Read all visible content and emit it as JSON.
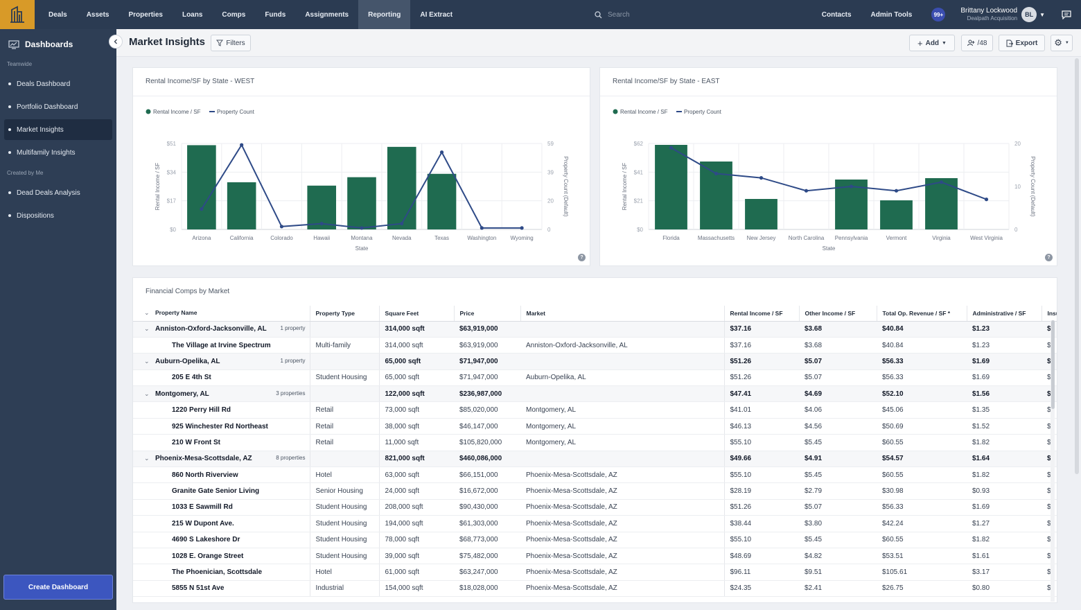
{
  "nav": {
    "items": [
      {
        "label": "Deals",
        "active": false
      },
      {
        "label": "Assets",
        "active": false
      },
      {
        "label": "Properties",
        "active": false
      },
      {
        "label": "Loans",
        "active": false
      },
      {
        "label": "Comps",
        "active": false
      },
      {
        "label": "Funds",
        "active": false
      },
      {
        "label": "Assignments",
        "active": false
      },
      {
        "label": "Reporting",
        "active": true
      },
      {
        "label": "AI Extract",
        "active": false
      }
    ],
    "search_placeholder": "Search",
    "contacts": "Contacts",
    "admin_tools": "Admin Tools",
    "notification_badge": "99+",
    "user_name": "Brittany Lockwood",
    "user_org": "Dealpath Acquisition",
    "avatar_initials": "BL",
    "colors": {
      "nav_bg": "#2b3b52",
      "logo_bg": "#d89a28",
      "active_bg": "#45556b"
    }
  },
  "sidebar": {
    "title": "Dashboards",
    "section_teamwide": "Teamwide",
    "teamwide": [
      {
        "label": "Deals Dashboard",
        "active": false
      },
      {
        "label": "Portfolio Dashboard",
        "active": false
      },
      {
        "label": "Market Insights",
        "active": true
      },
      {
        "label": "Multifamily Insights",
        "active": false
      }
    ],
    "section_mine": "Created by Me",
    "mine": [
      {
        "label": "Dead Deals Analysis",
        "active": false
      },
      {
        "label": "Dispositions",
        "active": false
      }
    ],
    "create_button": "Create Dashboard"
  },
  "header": {
    "title": "Market Insights",
    "filters": "Filters",
    "add": "Add",
    "share_count": "/48",
    "export": "Export"
  },
  "charts": {
    "west_title": "Rental Income/SF by State - WEST",
    "east_title": "Rental Income/SF by State - EAST",
    "table_title": "Financial Comps by Market"
  },
  "chart_data": [
    {
      "type": "bar",
      "title": "Rental Income/SF by State - WEST",
      "xlabel": "State",
      "ylabel": "Rental Income / SF",
      "y2label": "Property Count (Default)",
      "categories": [
        "Arizona",
        "California",
        "Colorado",
        "Hawaii",
        "Montana",
        "Nevada",
        "Texas",
        "Washington",
        "Wyoming"
      ],
      "series": [
        {
          "name": "Rental Income / SF",
          "type": "bar",
          "axis": "left",
          "values": [
            50,
            28,
            null,
            26,
            31,
            49,
            33,
            null,
            null
          ]
        },
        {
          "name": "Property Count",
          "type": "line",
          "axis": "right",
          "values": [
            14,
            58,
            2,
            4,
            1,
            4,
            53,
            1,
            1
          ]
        }
      ],
      "yticks": [
        "$0",
        "$17",
        "$34",
        "$51"
      ],
      "ylim": [
        0,
        51
      ],
      "y2ticks": [
        "0",
        "20",
        "39",
        "59"
      ],
      "y2lim": [
        0,
        59
      ],
      "legend": "top-left",
      "grid": true,
      "colors": {
        "bar": "#1f6b50",
        "line": "#2e4a87"
      }
    },
    {
      "type": "bar",
      "title": "Rental Income/SF by State - EAST",
      "xlabel": "State",
      "ylabel": "Rental Income / SF",
      "y2label": "Property Count (Default)",
      "categories": [
        "Florida",
        "Massachusetts",
        "New Jersey",
        "North Carolina",
        "Pennsylvania",
        "Vermont",
        "Virginia",
        "West Virginia"
      ],
      "series": [
        {
          "name": "Rental Income / SF",
          "type": "bar",
          "axis": "left",
          "values": [
            61,
            49,
            22,
            null,
            36,
            21,
            37,
            null
          ]
        },
        {
          "name": "Property Count",
          "type": "line",
          "axis": "right",
          "values": [
            19,
            13,
            12,
            9,
            10,
            9,
            11,
            7
          ]
        }
      ],
      "yticks": [
        "$0",
        "$21",
        "$41",
        "$62"
      ],
      "ylim": [
        0,
        62
      ],
      "y2ticks": [
        "0",
        "10",
        "20"
      ],
      "y2lim": [
        0,
        20
      ],
      "legend": "top-left",
      "grid": true,
      "colors": {
        "bar": "#1f6b50",
        "line": "#2e4a87"
      }
    }
  ],
  "table": {
    "columns": [
      "Property Name",
      "Property Type",
      "Square Feet",
      "Price",
      "Market",
      "Rental Income / SF",
      "Other Income / SF",
      "Total Op. Revenue / SF *",
      "Administrative / SF",
      "Insu"
    ],
    "rows": [
      {
        "kind": "group",
        "name": "Anniston-Oxford-Jacksonville, AL",
        "count": "1 property",
        "type": "",
        "sqft": "314,000 sqft",
        "price": "$63,919,000",
        "market": "",
        "rent": "$37.16",
        "other": "$3.68",
        "rev": "$40.84",
        "admin": "$1.23",
        "ins": "$"
      },
      {
        "kind": "child",
        "name": "The Village at Irvine Spectrum",
        "type": "Multi-family",
        "sqft": "314,000 sqft",
        "price": "$63,919,000",
        "market": "Anniston-Oxford-Jacksonville, AL",
        "rent": "$37.16",
        "other": "$3.68",
        "rev": "$40.84",
        "admin": "$1.23",
        "ins": "$"
      },
      {
        "kind": "group",
        "name": "Auburn-Opelika, AL",
        "count": "1 property",
        "type": "",
        "sqft": "65,000 sqft",
        "price": "$71,947,000",
        "market": "",
        "rent": "$51.26",
        "other": "$5.07",
        "rev": "$56.33",
        "admin": "$1.69",
        "ins": "$"
      },
      {
        "kind": "child",
        "name": "205 E 4th St",
        "type": "Student Housing",
        "sqft": "65,000 sqft",
        "price": "$71,947,000",
        "market": "Auburn-Opelika, AL",
        "rent": "$51.26",
        "other": "$5.07",
        "rev": "$56.33",
        "admin": "$1.69",
        "ins": "$"
      },
      {
        "kind": "group",
        "name": "Montgomery, AL",
        "count": "3 properties",
        "type": "",
        "sqft": "122,000 sqft",
        "price": "$236,987,000",
        "market": "",
        "rent": "$47.41",
        "other": "$4.69",
        "rev": "$52.10",
        "admin": "$1.56",
        "ins": "$"
      },
      {
        "kind": "child",
        "name": "1220 Perry Hill Rd",
        "type": "Retail",
        "sqft": "73,000 sqft",
        "price": "$85,020,000",
        "market": "Montgomery, AL",
        "rent": "$41.01",
        "other": "$4.06",
        "rev": "$45.06",
        "admin": "$1.35",
        "ins": "$"
      },
      {
        "kind": "child",
        "name": "925 Winchester Rd Northeast",
        "type": "Retail",
        "sqft": "38,000 sqft",
        "price": "$46,147,000",
        "market": "Montgomery, AL",
        "rent": "$46.13",
        "other": "$4.56",
        "rev": "$50.69",
        "admin": "$1.52",
        "ins": "$"
      },
      {
        "kind": "child",
        "name": "210 W Front St",
        "type": "Retail",
        "sqft": "11,000 sqft",
        "price": "$105,820,000",
        "market": "Montgomery, AL",
        "rent": "$55.10",
        "other": "$5.45",
        "rev": "$60.55",
        "admin": "$1.82",
        "ins": "$"
      },
      {
        "kind": "group",
        "name": "Phoenix-Mesa-Scottsdale, AZ",
        "count": "8 properties",
        "type": "",
        "sqft": "821,000 sqft",
        "price": "$460,086,000",
        "market": "",
        "rent": "$49.66",
        "other": "$4.91",
        "rev": "$54.57",
        "admin": "$1.64",
        "ins": "$"
      },
      {
        "kind": "child",
        "name": "860 North Riverview",
        "type": "Hotel",
        "sqft": "63,000 sqft",
        "price": "$66,151,000",
        "market": "Phoenix-Mesa-Scottsdale, AZ",
        "rent": "$55.10",
        "other": "$5.45",
        "rev": "$60.55",
        "admin": "$1.82",
        "ins": "$"
      },
      {
        "kind": "child",
        "name": "Granite Gate Senior Living",
        "type": "Senior Housing",
        "sqft": "24,000 sqft",
        "price": "$16,672,000",
        "market": "Phoenix-Mesa-Scottsdale, AZ",
        "rent": "$28.19",
        "other": "$2.79",
        "rev": "$30.98",
        "admin": "$0.93",
        "ins": "$"
      },
      {
        "kind": "child",
        "name": "1033 E Sawmill Rd",
        "type": "Student Housing",
        "sqft": "208,000 sqft",
        "price": "$90,430,000",
        "market": "Phoenix-Mesa-Scottsdale, AZ",
        "rent": "$51.26",
        "other": "$5.07",
        "rev": "$56.33",
        "admin": "$1.69",
        "ins": "$"
      },
      {
        "kind": "child",
        "name": "215 W Dupont Ave.",
        "type": "Student Housing",
        "sqft": "194,000 sqft",
        "price": "$61,303,000",
        "market": "Phoenix-Mesa-Scottsdale, AZ",
        "rent": "$38.44",
        "other": "$3.80",
        "rev": "$42.24",
        "admin": "$1.27",
        "ins": "$"
      },
      {
        "kind": "child",
        "name": "4690 S Lakeshore Dr",
        "type": "Student Housing",
        "sqft": "78,000 sqft",
        "price": "$68,773,000",
        "market": "Phoenix-Mesa-Scottsdale, AZ",
        "rent": "$55.10",
        "other": "$5.45",
        "rev": "$60.55",
        "admin": "$1.82",
        "ins": "$"
      },
      {
        "kind": "child",
        "name": "1028 E. Orange Street",
        "type": "Student Housing",
        "sqft": "39,000 sqft",
        "price": "$75,482,000",
        "market": "Phoenix-Mesa-Scottsdale, AZ",
        "rent": "$48.69",
        "other": "$4.82",
        "rev": "$53.51",
        "admin": "$1.61",
        "ins": "$"
      },
      {
        "kind": "child",
        "name": "The Phoenician, Scottsdale",
        "type": "Hotel",
        "sqft": "61,000 sqft",
        "price": "$63,247,000",
        "market": "Phoenix-Mesa-Scottsdale, AZ",
        "rent": "$96.11",
        "other": "$9.51",
        "rev": "$105.61",
        "admin": "$3.17",
        "ins": "$"
      },
      {
        "kind": "child",
        "name": "5855 N 51st Ave",
        "type": "Industrial",
        "sqft": "154,000 sqft",
        "price": "$18,028,000",
        "market": "Phoenix-Mesa-Scottsdale, AZ",
        "rent": "$24.35",
        "other": "$2.41",
        "rev": "$26.75",
        "admin": "$0.80",
        "ins": "$"
      }
    ]
  }
}
